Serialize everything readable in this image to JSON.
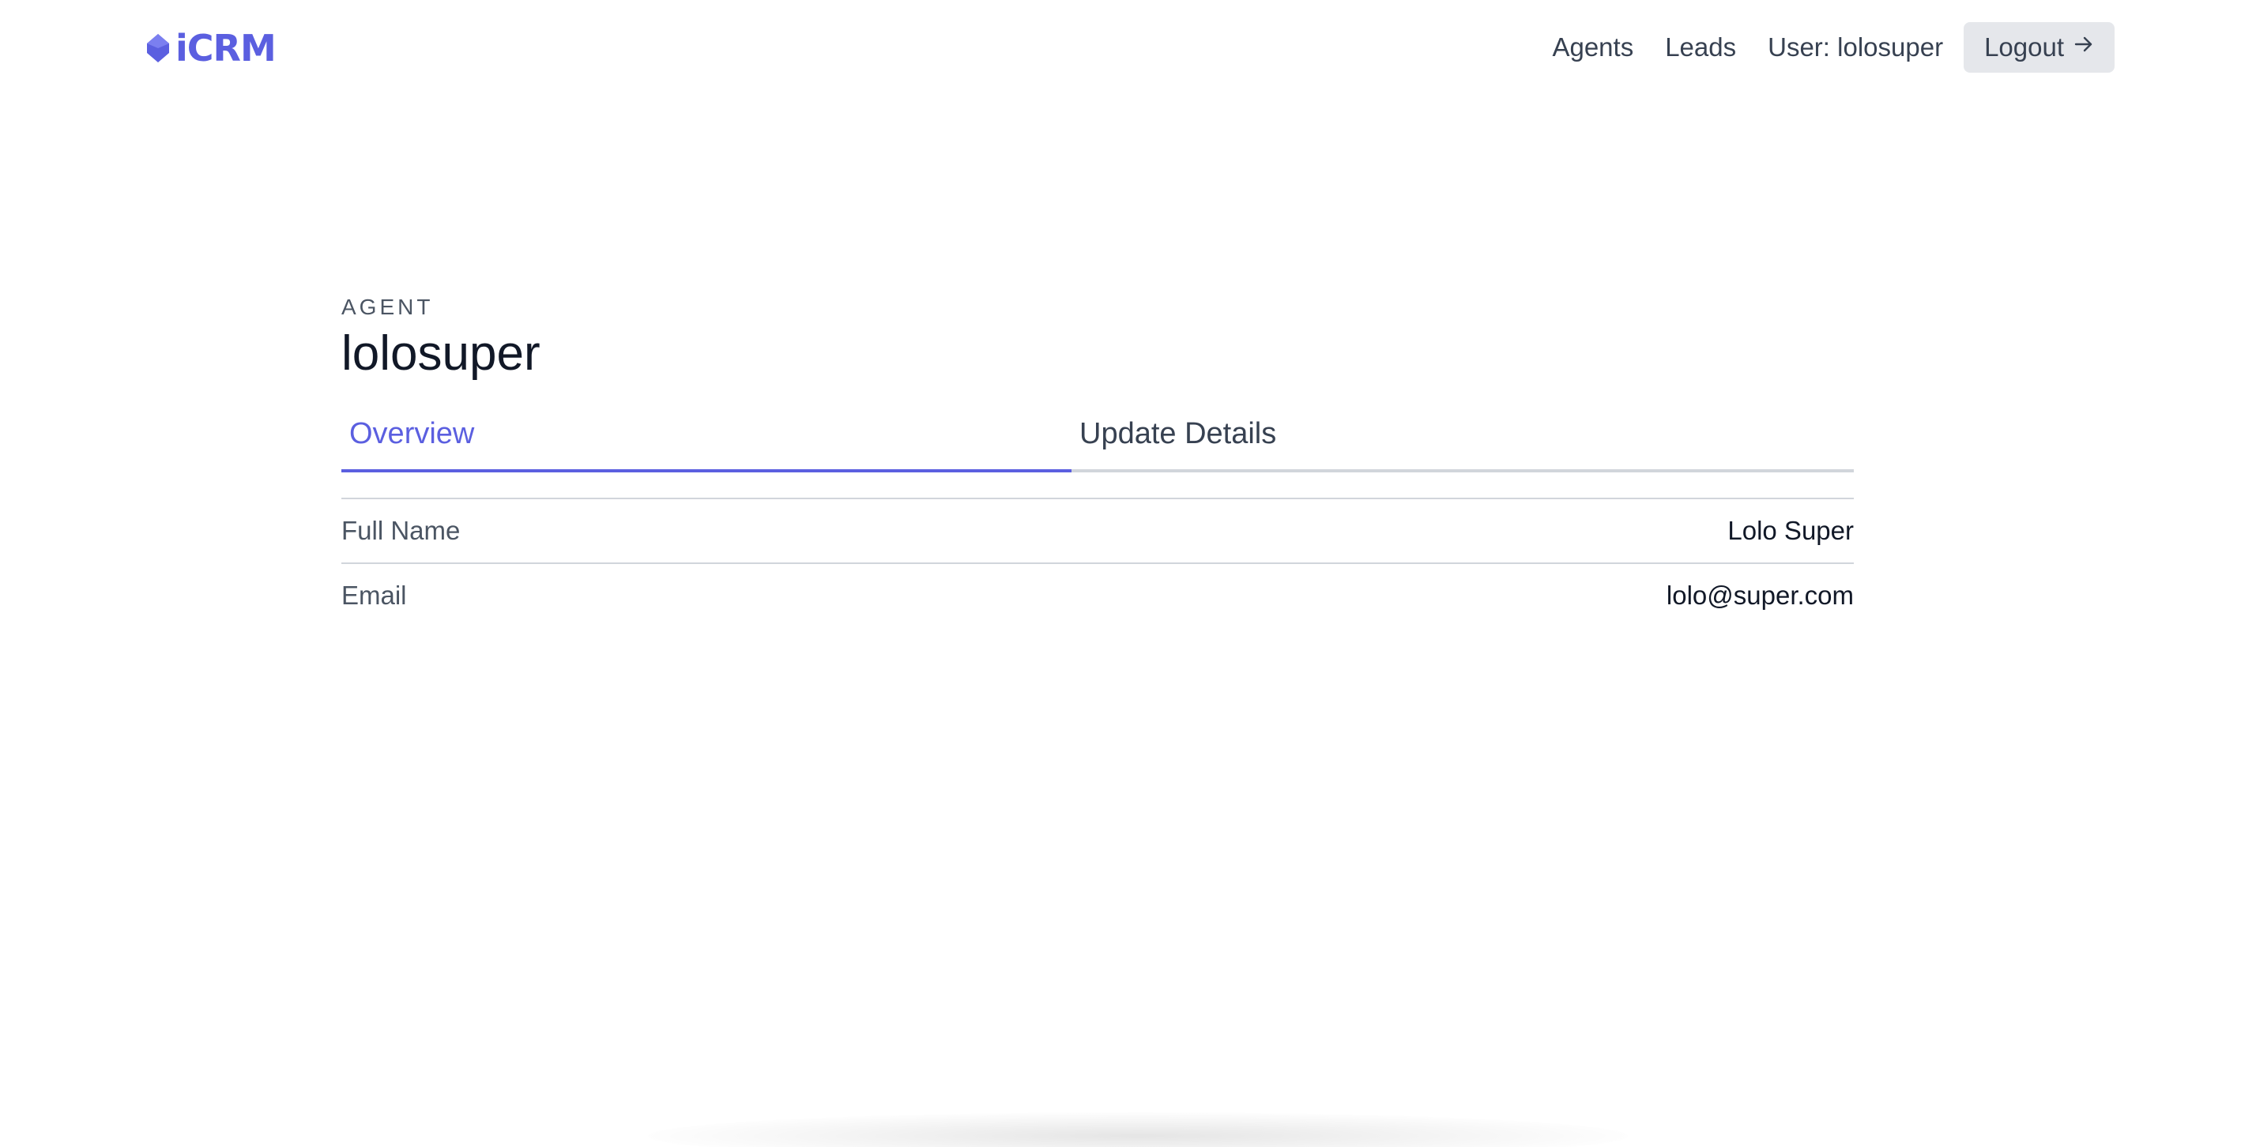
{
  "header": {
    "logo_text": "iCRM",
    "brand_color": "#5b5fe0",
    "nav": {
      "agents_label": "Agents",
      "leads_label": "Leads",
      "user_label": "User: lolosuper",
      "logout_label": "Logout",
      "logout_icon": "arrow-right-icon"
    }
  },
  "page": {
    "eyebrow": "AGENT",
    "title": "lolosuper",
    "tabs": [
      {
        "label": "Overview",
        "active": true
      },
      {
        "label": "Update Details",
        "active": false
      }
    ],
    "details": [
      {
        "label": "Full Name",
        "value": "Lolo Super"
      },
      {
        "label": "Email",
        "value": "lolo@super.com"
      }
    ]
  }
}
